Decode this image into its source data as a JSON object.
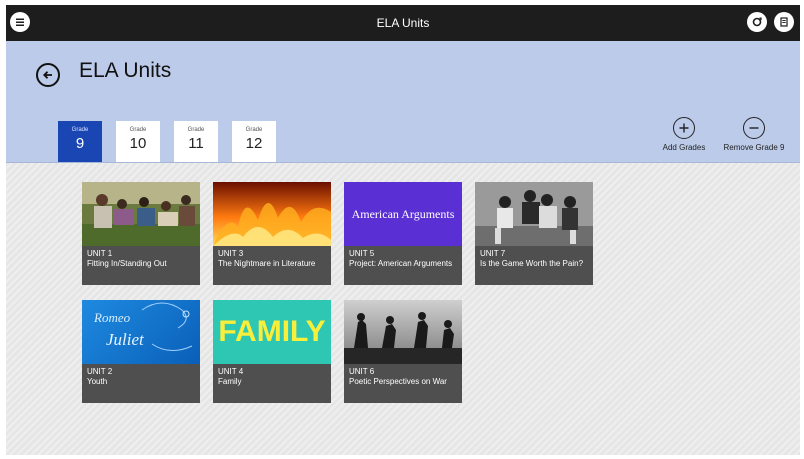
{
  "app": {
    "title": "ELA Units"
  },
  "header": {
    "title": "ELA Units"
  },
  "grades": [
    {
      "label": "Grade",
      "number": "9"
    },
    {
      "label": "Grade",
      "number": "10"
    },
    {
      "label": "Grade",
      "number": "11"
    },
    {
      "label": "Grade",
      "number": "12"
    }
  ],
  "actions": {
    "add": "Add Grades",
    "remove": "Remove Grade 9"
  },
  "units": [
    {
      "unit": "UNIT 1",
      "title": "Fitting In/Standing Out"
    },
    {
      "unit": "UNIT 3",
      "title": "The Nightmare in Literature"
    },
    {
      "unit": "UNIT 5",
      "title": "Project: American Arguments",
      "thumb_text": "American Arguments"
    },
    {
      "unit": "UNIT 7",
      "title": "Is the Game Worth the Pain?"
    },
    {
      "unit": "UNIT 2",
      "title": "Youth",
      "thumb_text_1": "Romeo",
      "thumb_text_2": "Juliet"
    },
    {
      "unit": "UNIT 4",
      "title": "Family",
      "thumb_text": "FAMILY"
    },
    {
      "unit": "UNIT 6",
      "title": "Poetic Perspectives on War"
    }
  ],
  "colors": {
    "titlebar": "#1d1d1d",
    "header": "#bccbe9",
    "active_grade": "#1a46b4",
    "tile": "#4f4f4f"
  }
}
